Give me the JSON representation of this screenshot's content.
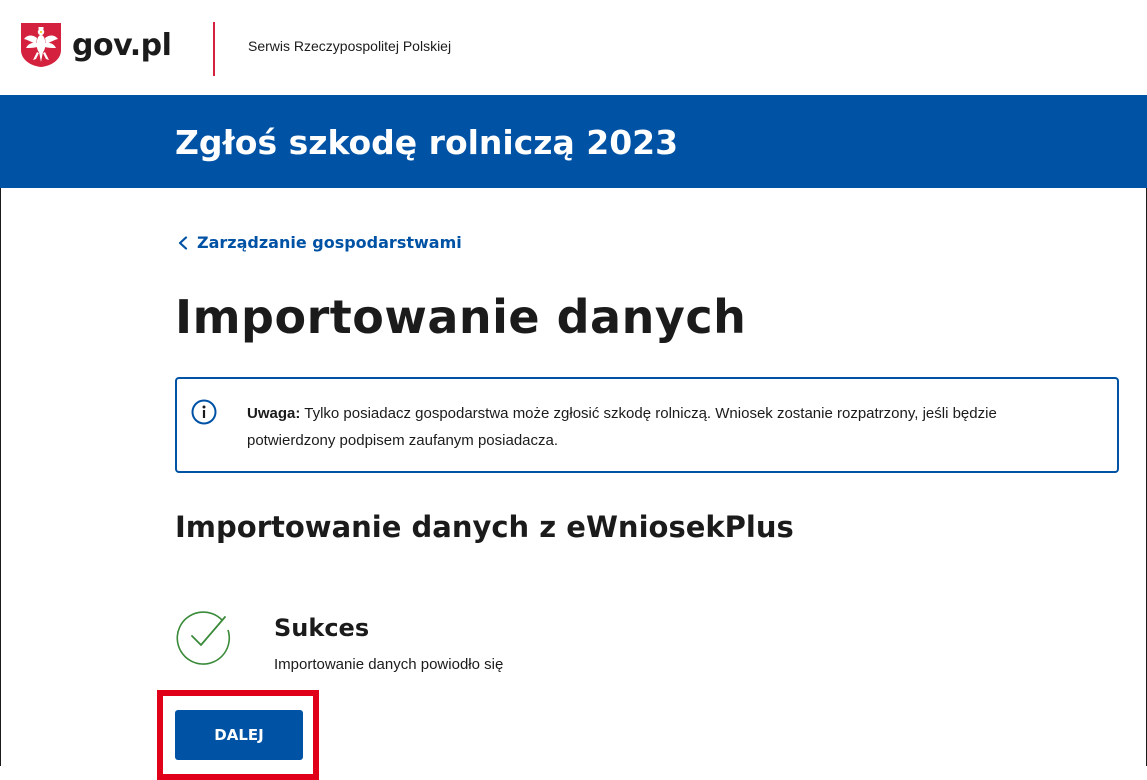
{
  "header": {
    "logo_text": "gov.pl",
    "service_name": "Serwis Rzeczypospolitej Polskiej"
  },
  "banner": {
    "title": "Zgłoś szkodę rolniczą 2023"
  },
  "breadcrumb": {
    "back_label": "Zarządzanie gospodarstwami"
  },
  "page": {
    "title": "Importowanie danych",
    "alert": {
      "prefix": "Uwaga:",
      "text": " Tylko posiadacz gospodarstwa może zgłosić szkodę rolniczą. Wniosek zostanie rozpatrzony, jeśli będzie potwierdzony podpisem zaufanym posiadacza."
    },
    "section_title": "Importowanie danych z eWniosekPlus",
    "status": {
      "title": "Sukces",
      "description": "Importowanie danych powiodło się"
    },
    "next_button": "DALEJ"
  },
  "colors": {
    "brand_blue": "#0052a5",
    "accent_red": "#d4213d",
    "success_green": "#3a8a3a",
    "highlight_red": "#e1001a"
  }
}
